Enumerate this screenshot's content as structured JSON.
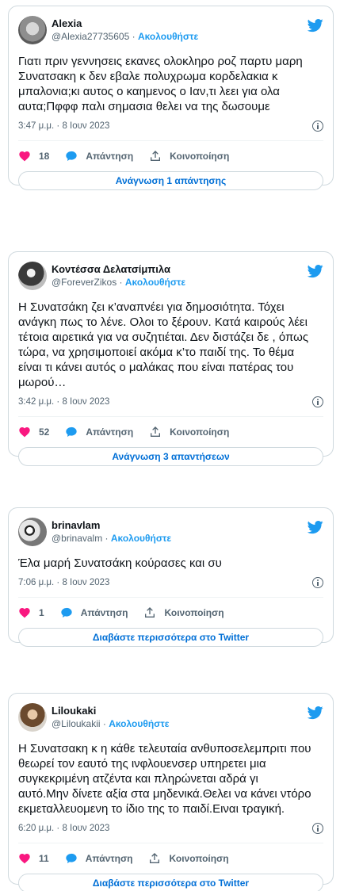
{
  "colors": {
    "accent": "#1d9bf0",
    "like": "#f91880",
    "text": "#0f1419",
    "muted": "#536471",
    "border": "#cfd9de"
  },
  "icons": {
    "like": "heart-icon",
    "reply": "reply-bubble-icon",
    "share": "share-upload-icon",
    "brand": "twitter-bird-icon",
    "info": "info-icon"
  },
  "tweets": [
    {
      "name": "Alexia",
      "handle": "@Alexia27735605",
      "sep": " · ",
      "follow": "Ακολουθήστε",
      "text": "Γιατι πριν γεννησεις εκανες ολοκληρο ροζ παρτυ μαρη\nΣυνατσακη κ δεν εβαλε πολυχρωμα κορδελακια κ\nμπαλονια;κι αυτος ο καημενος ο Ιαν,τι λεει για ολα\nαυτα;Πφφφ παλι σημασια θελει να της δωσουμε",
      "time": "3:47 μ.μ. · 8 Ιουν 2023",
      "likes": "18",
      "reply": "Απάντηση",
      "share": "Κοινοποίηση",
      "button": "Ανάγνωση 1 απάντησης"
    },
    {
      "name": "Κοντέσσα Δελατσίμπιλα",
      "handle": "@ForeverZikos",
      "sep": " · ",
      "follow": "Ακολουθήστε",
      "text": "Η Συνατσάκη ζει κ’αναπνέει για δημοσιότητα. Τόχει\nανάγκη πως το λένε. Ολοι το ξέρουν.  Κατά καιρούς λέει\nτέτοια αιρετικά για να συζητιέται. Δεν διστάζει δε , όπως\nτώρα, να χρησιμοποιεί ακόμα κ’το παιδί της. Το θέμα\nείναι τι κάνει αυτός ο μαλάκας που είναι πατέρας του\nμωρού…",
      "time": "3:42 μ.μ. · 8 Ιουν 2023",
      "likes": "52",
      "reply": "Απάντηση",
      "share": "Κοινοποίηση",
      "button": "Ανάγνωση 3 απαντήσεων"
    },
    {
      "name": "brinavlam",
      "handle": "@brinavalm",
      "sep": " · ",
      "follow": "Ακολουθήστε",
      "text": "Έλα μαρή Συνατσάκη κούρασες και συ",
      "time": "7:06 μ.μ. · 8 Ιουν 2023",
      "likes": "1",
      "reply": "Απάντηση",
      "share": "Κοινοποίηση",
      "button": "Διαβάστε περισσότερα στο Twitter"
    },
    {
      "name": "Liloukaki",
      "handle": "@Liloukakii",
      "sep": " · ",
      "follow": "Ακολουθήστε",
      "text": "Η Συνατσακη κ η κάθε τελευταία ανθυποσελεμπριτι που\nθεωρεί τον εαυτό της ινφλουενσερ υπηρετει μια\nσυγκεκριμένη ατζέντα και πληρώνεται αδρά γι\nαυτό.Μην δίνετε αξία στα μηδενικά.Θελει να κάνει ντόρο\nεκμεταλλευομενη το ίδιο της το παιδί.Ειναι τραγική.",
      "time": "6:20 μ.μ. · 8 Ιουν 2023",
      "likes": "11",
      "reply": "Απάντηση",
      "share": "Κοινοποίηση",
      "button": "Διαβάστε περισσότερα στο Twitter"
    }
  ]
}
